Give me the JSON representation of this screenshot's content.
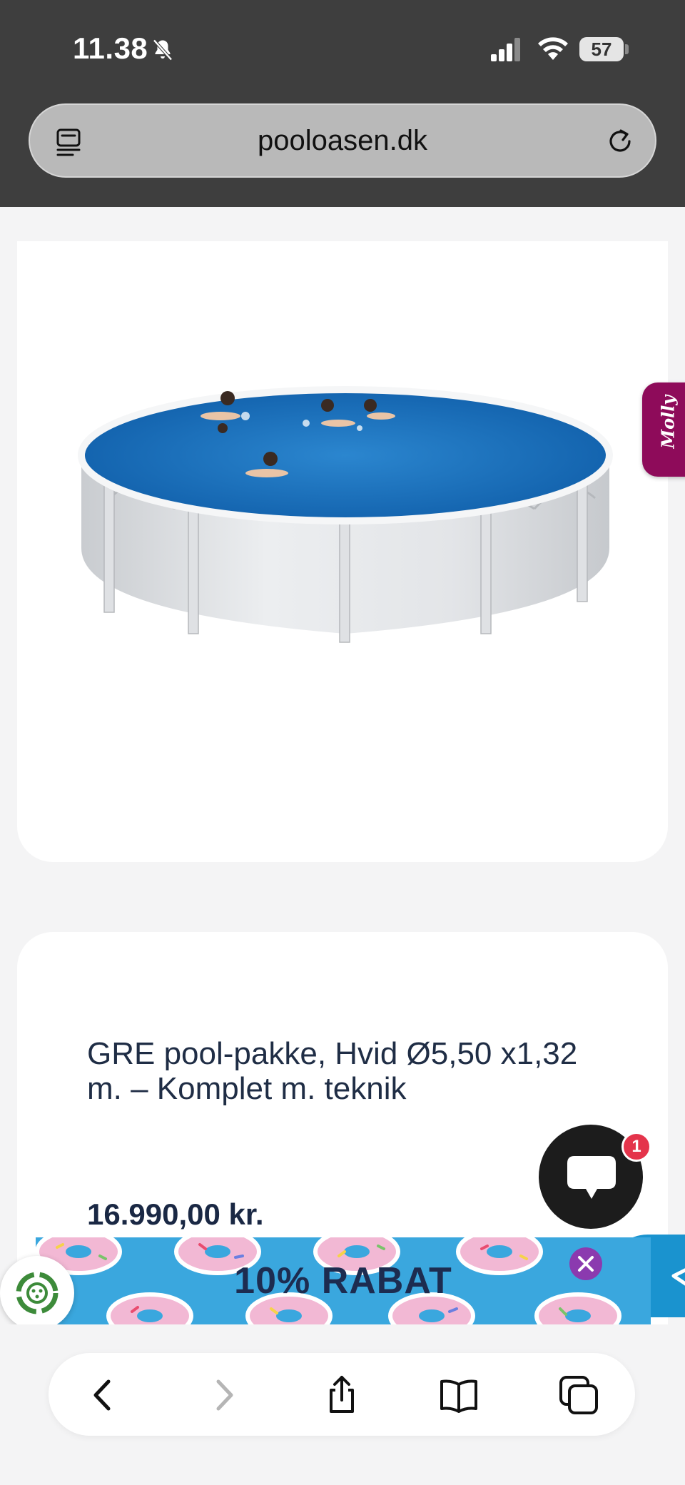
{
  "status_bar": {
    "time": "11.38",
    "battery": "57",
    "icons": [
      "bell-slash-icon",
      "signal-icon",
      "wifi-icon",
      "battery-icon"
    ]
  },
  "browser": {
    "url": "pooloasen.dk",
    "icons": [
      "reader-icon",
      "reload-icon"
    ]
  },
  "product": {
    "image_alt": "Round white above-ground pool with swimmers",
    "title": "GRE pool-pakke, Hvid Ø5,50 x1,32 m. – Komplet m. teknik",
    "price": "16.990,00 kr."
  },
  "side_tab": {
    "label": "Molly"
  },
  "chat": {
    "badge_count": "1"
  },
  "banner": {
    "text": "10% RABAT"
  },
  "toolbar": {
    "items": [
      "back-icon",
      "forward-icon",
      "share-icon",
      "bookmarks-icon",
      "tabs-icon"
    ]
  },
  "colors": {
    "topbar": "#3e3e3e",
    "molly": "#8e0b5a",
    "chat": "#1c1c1c",
    "badge": "#e4344b",
    "banner": "#3aa7de",
    "close": "#8b3aaf",
    "title_text": "#1f2d45"
  }
}
